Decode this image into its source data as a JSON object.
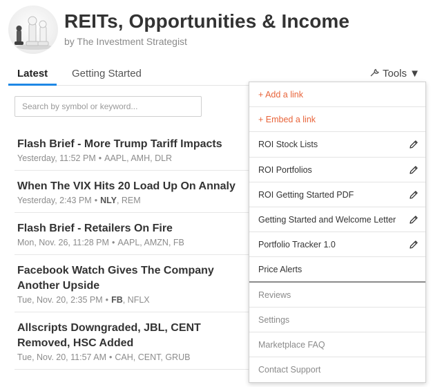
{
  "header": {
    "title": "REITs, Opportunities & Income",
    "subtitle": "by The Investment Strategist"
  },
  "tabs": [
    {
      "label": "Latest",
      "active": true
    },
    {
      "label": "Getting Started",
      "active": false
    }
  ],
  "tools": {
    "label": "Tools ▼",
    "icon": "wrench-icon"
  },
  "search": {
    "placeholder": "Search by symbol or keyword..."
  },
  "articles": [
    {
      "title": "Flash Brief - More Trump Tariff Impacts",
      "date": "Yesterday, 11:52 PM",
      "tickers_bold": "",
      "tickers": "AAPL, AMH, DLR"
    },
    {
      "title": "When The VIX Hits 20 Load Up On Annaly",
      "date": "Yesterday, 2:43 PM",
      "tickers_bold": "NLY",
      "tickers": ", REM"
    },
    {
      "title": "Flash Brief - Retailers On Fire",
      "date": "Mon, Nov. 26, 11:28 PM",
      "tickers_bold": "",
      "tickers": "AAPL, AMZN, FB"
    },
    {
      "title": "Facebook Watch Gives The Company Another Upside",
      "date": "Tue, Nov. 20, 2:35 PM",
      "tickers_bold": "FB",
      "tickers": ", NFLX"
    },
    {
      "title": "Allscripts Downgraded, JBL, CENT Removed, HSC Added",
      "date": "Tue, Nov. 20, 11:57 AM",
      "tickers_bold": "",
      "tickers": "CAH, CENT, GRUB"
    }
  ],
  "meta_separator": "•",
  "tools_menu": {
    "items": [
      {
        "label": "+ Add a link",
        "style": "add",
        "editable": false
      },
      {
        "label": "+ Embed a link",
        "style": "add",
        "editable": false
      },
      {
        "label": "ROI Stock Lists",
        "style": "normal",
        "editable": true
      },
      {
        "label": "ROI Portfolios",
        "style": "normal",
        "editable": true
      },
      {
        "label": "ROI Getting Started PDF",
        "style": "normal",
        "editable": true
      },
      {
        "label": "Getting Started and Welcome Letter",
        "style": "normal",
        "editable": true
      },
      {
        "label": "Portfolio Tracker 1.0",
        "style": "normal",
        "editable": true
      },
      {
        "label": "Price Alerts",
        "style": "section-end",
        "editable": false
      },
      {
        "label": "Reviews",
        "style": "muted",
        "editable": false
      },
      {
        "label": "Settings",
        "style": "muted",
        "editable": false
      },
      {
        "label": "Marketplace FAQ",
        "style": "muted",
        "editable": false
      },
      {
        "label": "Contact Support",
        "style": "muted",
        "editable": false
      }
    ]
  },
  "colors": {
    "accent": "#1e88e5",
    "add_link": "#e8643a",
    "muted": "#8a8a8a"
  }
}
